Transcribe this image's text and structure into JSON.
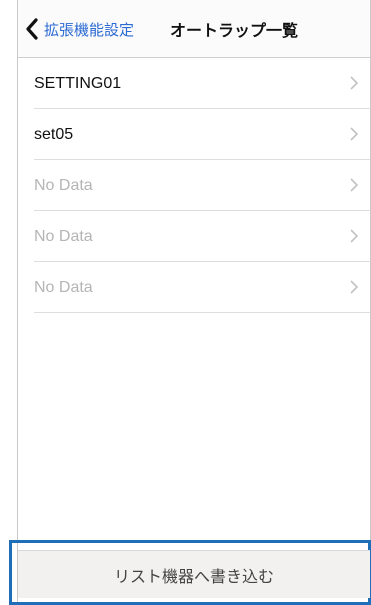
{
  "navbar": {
    "back_label": "拡張機能設定",
    "title": "オートラップ一覧"
  },
  "list": {
    "items": [
      {
        "label": "SETTING01",
        "empty": false
      },
      {
        "label": "set05",
        "empty": false
      },
      {
        "label": "No Data",
        "empty": true
      },
      {
        "label": "No Data",
        "empty": true
      },
      {
        "label": "No Data",
        "empty": true
      }
    ]
  },
  "footer": {
    "button_label": "リスト機器へ書き込む"
  },
  "colors": {
    "accent": "#2a6ad2",
    "highlight_outline": "#1f6fb8",
    "muted_text": "#b5b5b5"
  },
  "icons": {
    "back": "chevron-left-icon",
    "disclosure": "chevron-right-icon"
  }
}
